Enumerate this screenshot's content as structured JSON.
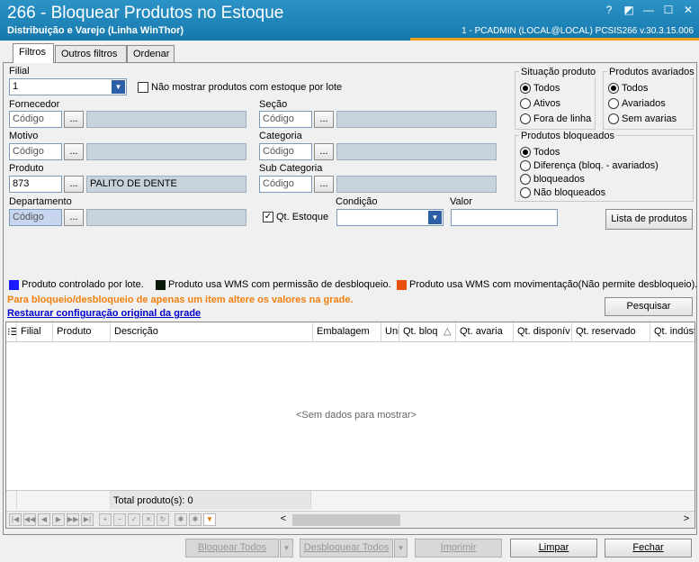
{
  "window": {
    "title": "266 - Bloquear Produtos no Estoque",
    "subtitle": "Distribuição e Varejo (Linha WinThor)",
    "user_info": "1 - PCADMIN (LOCAL@LOCAL)   PCSIS266  v.30.3.15.006",
    "help": "?",
    "restore": "◩",
    "minimize": "—",
    "maximize": "☐",
    "close": "✕"
  },
  "tabs": [
    "Filtros",
    "Outros filtros",
    "Ordenar"
  ],
  "filters": {
    "filial_label": "Filial",
    "filial_value": "1",
    "no_lot_label": "Não mostrar produtos com estoque por lote",
    "fornecedor_label": "Fornecedor",
    "secao_label": "Seção",
    "motivo_label": "Motivo",
    "categoria_label": "Categoria",
    "produto_label": "Produto",
    "produto_code": "873",
    "produto_desc": "PALITO DE DENTE",
    "subcategoria_label": "Sub Categoria",
    "departamento_label": "Departamento",
    "codigo_placeholder": "Código",
    "ellipsis": "...",
    "qt_estoque_label": "Qt. Estoque",
    "qt_estoque_mark": "✓",
    "condicao_label": "Condição",
    "valor_label": "Valor",
    "lista_produtos": "Lista de produtos"
  },
  "situacao": {
    "title": "Situação produto",
    "options": [
      "Todos",
      "Ativos",
      "Fora de linha"
    ]
  },
  "avariados": {
    "title": "Produtos avariados",
    "options": [
      "Todos",
      "Avariados",
      "Sem avarias"
    ]
  },
  "bloqueados": {
    "title": "Produtos bloqueados",
    "options": [
      "Todos",
      "Diferença (bloq. - avariados)",
      "bloqueados",
      "Não bloqueados"
    ]
  },
  "legend": {
    "items": [
      {
        "label": "Produto controlado por lote.",
        "color": "#1a1aff"
      },
      {
        "label": "Produto usa WMS com permissão de desbloqueio.",
        "color": "#0a1a0a"
      },
      {
        "label": "Produto usa WMS com movimentação(Não permite desbloqueio).",
        "color": "#e8500a"
      }
    ],
    "hint": "Para bloqueio/desbloqueio de apenas um item altere os valores na grade.",
    "hint_color": "#f08010",
    "restore_link": "Restaurar configuração original da grade",
    "pesquisar": "Pesquisar"
  },
  "grid": {
    "row_indicator": "⁝☰",
    "columns": [
      "Filial",
      "Produto",
      "Descrição",
      "Embalagem",
      "Uni",
      "Qt. bloq",
      "Qt. avaria",
      "Qt. disponív",
      "Qt. reservado",
      "Qt. indúst"
    ],
    "sort_mark": "△",
    "empty": "<Sem dados para mostrar>",
    "total": "Total produto(s): 0"
  },
  "navigator": [
    "|◀",
    "◀◀",
    "◀",
    "▶",
    "▶▶",
    "▶|",
    "+",
    "−",
    "✓",
    "✕",
    "↻",
    "✱",
    "✱",
    "▼"
  ],
  "scroll": {
    "left": "<",
    "right": ">"
  },
  "buttons": {
    "bloquear": "Bloquear Todos",
    "desbloquear": "Desbloquear Todos",
    "imprimir": "Imprimir",
    "limpar": "Limpar",
    "fechar": "Fechar",
    "dropdown": "▼"
  }
}
